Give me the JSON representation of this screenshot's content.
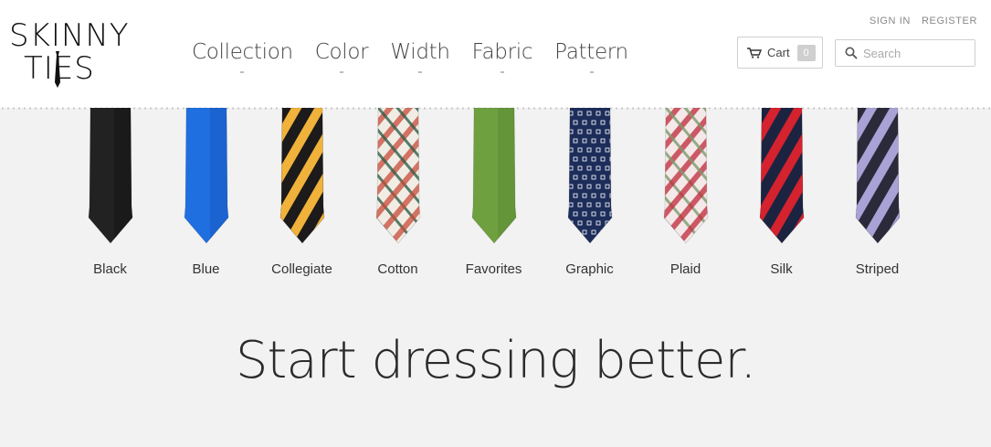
{
  "header": {
    "logo": {
      "line1": "SKINNY",
      "line2": "TIES"
    },
    "nav": [
      {
        "label": "Collection",
        "name": "nav-collection"
      },
      {
        "label": "Color",
        "name": "nav-color"
      },
      {
        "label": "Width",
        "name": "nav-width"
      },
      {
        "label": "Fabric",
        "name": "nav-fabric"
      },
      {
        "label": "Pattern",
        "name": "nav-pattern"
      }
    ],
    "utility": {
      "sign_in": "SIGN IN",
      "register": "REGISTER"
    },
    "cart": {
      "label": "Cart",
      "count": "0",
      "icon": "cart-icon"
    },
    "search": {
      "placeholder": "Search",
      "value": "",
      "icon": "search-icon"
    }
  },
  "ties": [
    {
      "label": "Black",
      "pattern": "solid",
      "colors": [
        "#222222",
        "#111111"
      ]
    },
    {
      "label": "Blue",
      "pattern": "solid",
      "colors": [
        "#1f6fe0",
        "#1658c0"
      ]
    },
    {
      "label": "Collegiate",
      "pattern": "stripe",
      "colors": [
        "#1c1a1a",
        "#f0b23a"
      ]
    },
    {
      "label": "Cotton",
      "pattern": "plaid",
      "colors": [
        "#f1ede4",
        "#c74a3a",
        "#2f5e4a"
      ]
    },
    {
      "label": "Favorites",
      "pattern": "solid",
      "colors": [
        "#6fa040",
        "#5a8a32"
      ]
    },
    {
      "label": "Graphic",
      "pattern": "dots",
      "colors": [
        "#1d2d5a",
        "#e8e8f0"
      ]
    },
    {
      "label": "Plaid",
      "pattern": "plaid",
      "colors": [
        "#f4e8e8",
        "#c0283a",
        "#7a9a6a"
      ]
    },
    {
      "label": "Silk",
      "pattern": "stripe",
      "colors": [
        "#1c2340",
        "#d4222e"
      ]
    },
    {
      "label": "Striped",
      "pattern": "stripe",
      "colors": [
        "#2a2a3a",
        "#a9a2d6"
      ]
    }
  ],
  "main": {
    "tagline": "Start dressing better."
  }
}
